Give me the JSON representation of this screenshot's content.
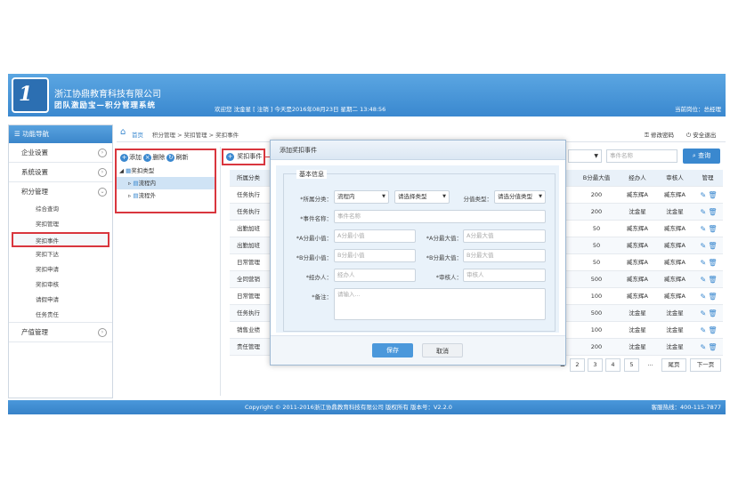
{
  "header": {
    "company": "浙江协鼎教育科技有限公司",
    "slogan": "团队激励宝—积分管理系统",
    "welcome": "欢迎您 沈金星 [ 注销 ] 今天是2016年08月23日 星期二 13:48:56",
    "post": "当前岗位：总经理",
    "logo_text": "1"
  },
  "sidebar": {
    "title": "功能导航",
    "menus": [
      {
        "label": "企业设置"
      },
      {
        "label": "系统设置"
      },
      {
        "label": "积分管理"
      }
    ],
    "subs": [
      "综合查询",
      "奖扣管理",
      "奖扣事件",
      "奖扣下达",
      "奖扣申请",
      "奖扣审核",
      "请假申请",
      "任务责任"
    ],
    "last_menu": "产值管理"
  },
  "breadcrumb": {
    "home": "首页",
    "path": "积分管理 > 奖扣管理 > 奖扣事件"
  },
  "topbar": {
    "change_pwd": "修改密码",
    "logout": "安全退出"
  },
  "tree": {
    "add": "添加",
    "delete": "删除",
    "refresh": "刷新",
    "root": "奖扣类型",
    "node1": "流程内",
    "node2": "流程外"
  },
  "toolbar": {
    "add_event": "奖扣事件",
    "search_placeholder": "事件名称",
    "search": "查询"
  },
  "table": {
    "headers": [
      "所属分类",
      "B分最大值",
      "经办人",
      "审核人",
      "管理"
    ],
    "rows": [
      {
        "cat": "任务执行",
        "bmax": "200",
        "handler": "臧东辉A",
        "auditor": "臧东辉A"
      },
      {
        "cat": "任务执行",
        "bmax": "200",
        "handler": "沈金星",
        "auditor": "沈金星"
      },
      {
        "cat": "出勤加班",
        "bmax": "50",
        "handler": "臧东辉A",
        "auditor": "臧东辉A"
      },
      {
        "cat": "出勤加班",
        "bmax": "50",
        "handler": "臧东辉A",
        "auditor": "臧东辉A"
      },
      {
        "cat": "日常管理",
        "bmax": "50",
        "handler": "臧东辉A",
        "auditor": "臧东辉A"
      },
      {
        "cat": "全同营销",
        "bmax": "500",
        "handler": "臧东辉A",
        "auditor": "臧东辉A"
      },
      {
        "cat": "日常管理",
        "bmax": "100",
        "handler": "臧东辉A",
        "auditor": "臧东辉A"
      },
      {
        "cat": "任务执行",
        "bmax": "500",
        "handler": "沈金星",
        "auditor": "沈金星"
      },
      {
        "cat": "销售业绩",
        "bmax": "100",
        "handler": "沈金星",
        "auditor": "沈金星"
      },
      {
        "cat": "责任管理",
        "bmax": "200",
        "handler": "沈金星",
        "auditor": "沈金星"
      }
    ]
  },
  "pagination": {
    "pages": [
      "2",
      "3",
      "4",
      "5"
    ],
    "ellipsis": "...",
    "last": "尾页",
    "next": "下一页"
  },
  "modal": {
    "title": "添加奖扣事件",
    "legend": "基本信息",
    "cat_label": "*所属分类：",
    "cat_value": "流程内",
    "sub_value": "请选择类型",
    "score_type_label": "分值类型：",
    "score_type_value": "请选分值类型",
    "name_label": "*事件名称：",
    "name_ph": "事件名称",
    "amin_label": "*A分最小值：",
    "amin_ph": "A分最小值",
    "amax_label": "*A分最大值：",
    "amax_ph": "A分最大值",
    "bmin_label": "*B分最小值：",
    "bmin_ph": "B分最小值",
    "bmax_label": "*B分最大值：",
    "bmax_ph": "B分最大值",
    "handler_label": "*经办人：",
    "handler_ph": "经办人",
    "auditor_label": "*审核人：",
    "auditor_ph": "审核人",
    "remark_label": "*备注：",
    "remark_ph": "请输入...",
    "save": "保存",
    "cancel": "取消"
  },
  "footer": {
    "copyright": "Copyright © 2011-2016浙江协鼎教育科技有限公司 版权所有  版本号：V2.2.0",
    "hotline": "客服热线：400-115-7877"
  },
  "colors": {
    "accent": "#3a88cf",
    "highlight": "#d9363e"
  }
}
